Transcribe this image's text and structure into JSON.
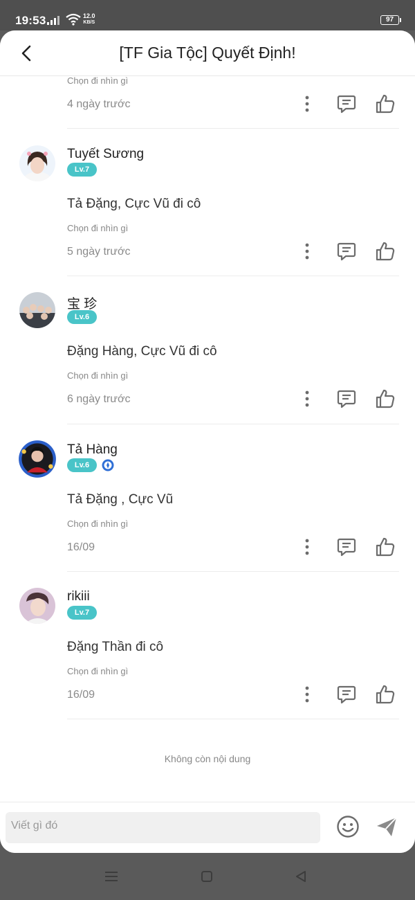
{
  "status_bar": {
    "time": "19:53",
    "net_speed_value": "12.0",
    "net_speed_unit": "KB/S",
    "battery": "97"
  },
  "header": {
    "title": "[TF Gia Tộc] Quyết Định!"
  },
  "colors": {
    "level_badge": "#49c4c8",
    "icon_gray": "#6b6b6b"
  },
  "partial_comment": {
    "hint": "Chọn đi nhìn gì",
    "time": "4 ngày trước"
  },
  "comments": [
    {
      "username": "Tuyết Sương",
      "level": "Lv.7",
      "content": "Tả Đặng, Cực Vũ đi cô",
      "hint": "Chọn đi nhìn gì",
      "time": "5 ngày trước"
    },
    {
      "username": "宝 珍",
      "level": "Lv.6",
      "content": "Đặng Hàng, Cực Vũ đi cô",
      "hint": "Chọn đi nhìn gì",
      "time": "6 ngày trước"
    },
    {
      "username": "Tả Hàng",
      "level": "Lv.6",
      "content": "Tả Đặng , Cực Vũ",
      "hint": "Chọn đi nhìn gì",
      "time": "16/09"
    },
    {
      "username": "rikiii",
      "level": "Lv.7",
      "content": "Đặng Thần đi cô",
      "hint": "Chọn đi nhìn gì",
      "time": "16/09"
    }
  ],
  "end_text": "Không còn nội dung",
  "input": {
    "placeholder": "Viết gì đó"
  }
}
